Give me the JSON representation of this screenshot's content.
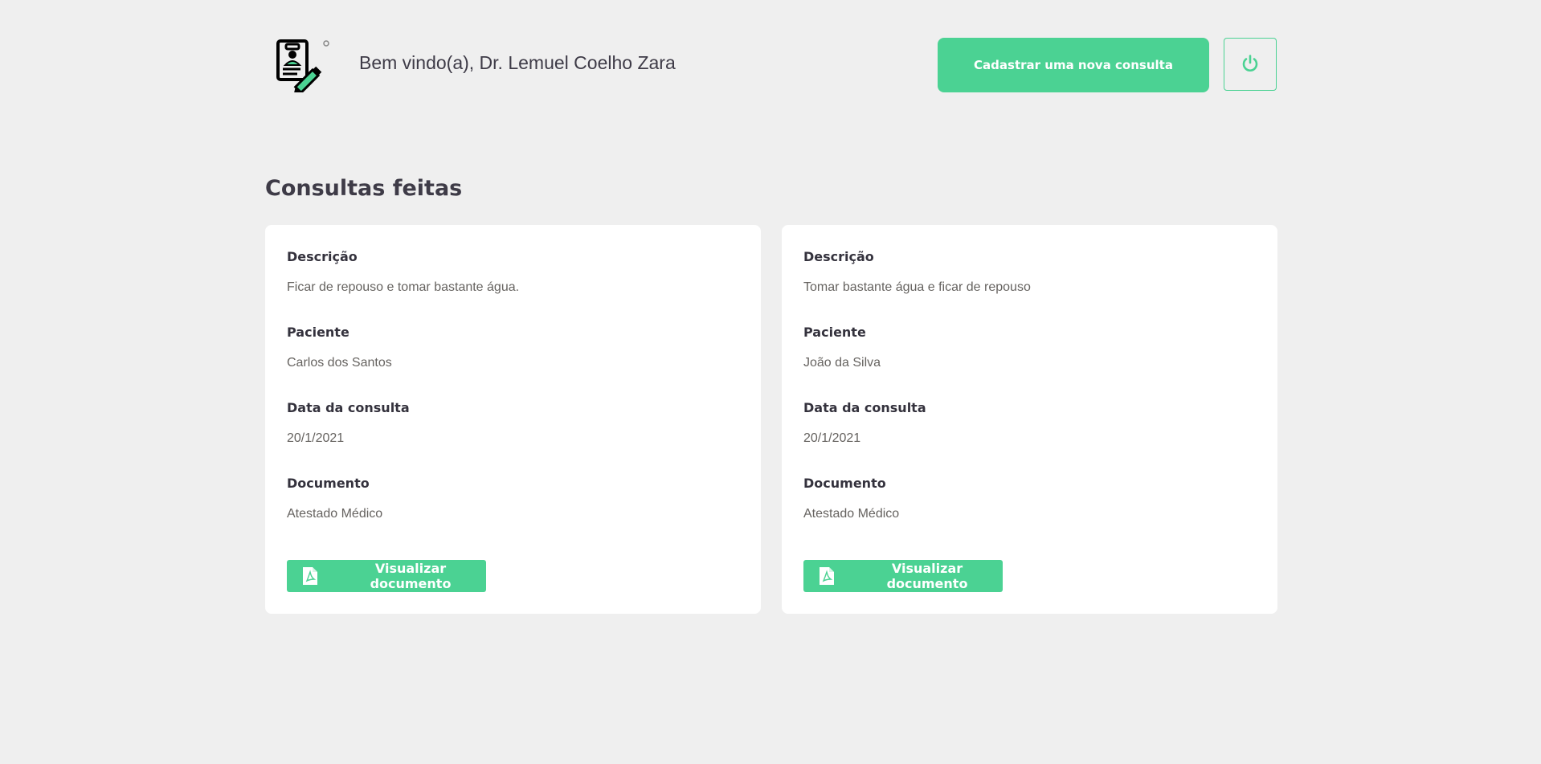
{
  "header": {
    "welcome_text": "Bem vindo(a), Dr. Lemuel Coelho Zara",
    "new_consult_label": "Cadastrar uma nova consulta",
    "logo_icon": "medical-record-edit-icon",
    "power_icon": "power-icon"
  },
  "main": {
    "title": "Consultas feitas",
    "cards": [
      {
        "description_label": "Descrição",
        "description": "Ficar de repouso e tomar bastante água.",
        "patient_label": "Paciente",
        "patient": "Carlos dos Santos",
        "date_label": "Data da consulta",
        "date": "20/1/2021",
        "document_label": "Documento",
        "document": "Atestado Médico",
        "button_label": "Visualizar documento"
      },
      {
        "description_label": "Descrição",
        "description": "Tomar bastante água e ficar de repouso",
        "patient_label": "Paciente",
        "patient": "João da Silva",
        "date_label": "Data da consulta",
        "date": "20/1/2021",
        "document_label": "Documento",
        "document": "Atestado Médico",
        "button_label": "Visualizar documento"
      }
    ]
  },
  "colors": {
    "accent": "#4bd293",
    "background": "#efefef",
    "card": "#ffffff",
    "heading": "#3e3b47",
    "muted": "#666360"
  }
}
